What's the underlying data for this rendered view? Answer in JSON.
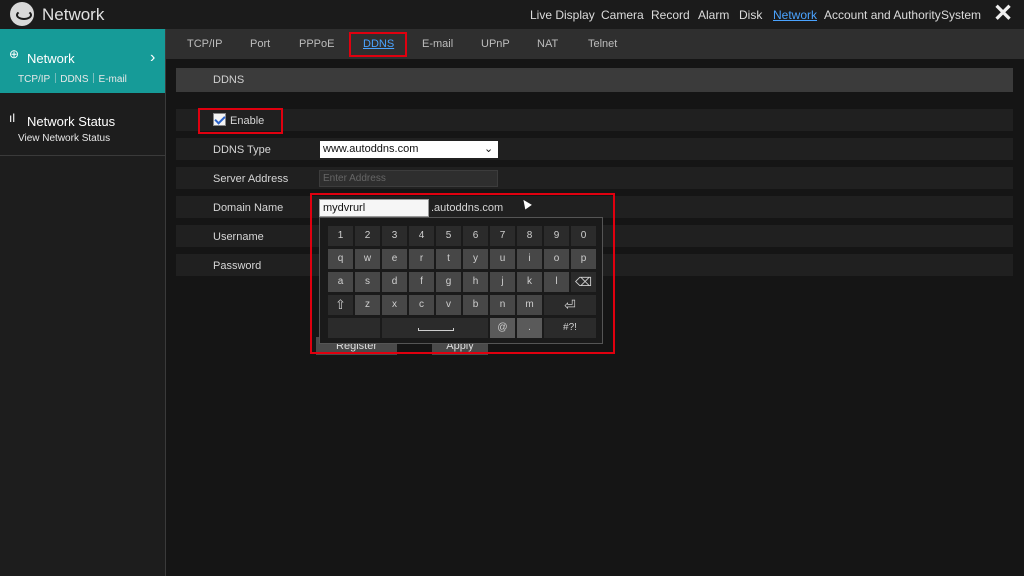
{
  "app": {
    "title": "Network"
  },
  "top_nav": [
    "Live Display",
    "Camera",
    "Record",
    "Alarm",
    "Disk",
    "Network",
    "Account and Authority",
    "System"
  ],
  "sidebar": {
    "network": {
      "title": "Network",
      "subtitle": "TCP/IP｜DDNS｜E-mail"
    },
    "status": {
      "title": "Network Status",
      "subtitle": "View Network Status"
    }
  },
  "tabs": [
    "TCP/IP",
    "Port",
    "PPPoE",
    "DDNS",
    "E-mail",
    "UPnP",
    "NAT",
    "Telnet"
  ],
  "active_tab": "DDNS",
  "form": {
    "section_title": "DDNS",
    "enable_label": "Enable",
    "enable_checked": true,
    "ddns_type_label": "DDNS Type",
    "ddns_type_value": "www.autoddns.com",
    "server_address_label": "Server Address",
    "server_address_placeholder": "Enter Address",
    "domain_name_label": "Domain Name",
    "domain_name_value": "mydvrurl",
    "domain_suffix": ".autoddns.com",
    "username_label": "Username",
    "password_label": "Password",
    "register_label": "Register",
    "apply_label": "Apply"
  },
  "keyboard": {
    "row1": [
      "1",
      "2",
      "3",
      "4",
      "5",
      "6",
      "7",
      "8",
      "9",
      "0"
    ],
    "row2": [
      "q",
      "w",
      "e",
      "r",
      "t",
      "y",
      "u",
      "i",
      "o",
      "p"
    ],
    "row3": [
      "a",
      "s",
      "d",
      "f",
      "g",
      "h",
      "j",
      "k",
      "l"
    ],
    "row4": [
      "z",
      "x",
      "c",
      "v",
      "b",
      "n",
      "m"
    ],
    "at_key": "@",
    "dot_key": ".",
    "symbols_key": "#?!"
  },
  "colors": {
    "accent": "#169b98",
    "link": "#4aa3ff",
    "highlight": "#e0000f"
  }
}
